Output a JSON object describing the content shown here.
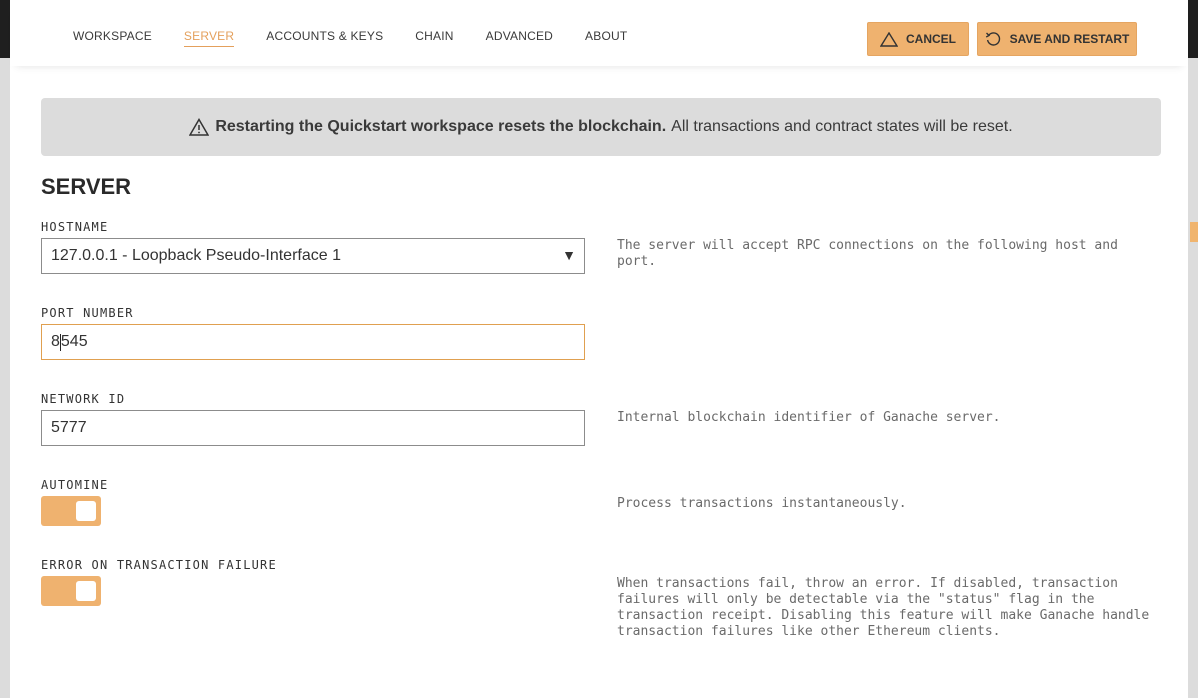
{
  "nav": {
    "items": [
      {
        "label": "WORKSPACE"
      },
      {
        "label": "SERVER",
        "active": true
      },
      {
        "label": "ACCOUNTS & KEYS"
      },
      {
        "label": "CHAIN"
      },
      {
        "label": "ADVANCED"
      },
      {
        "label": "ABOUT"
      }
    ]
  },
  "buttons": {
    "cancel_label": "CANCEL",
    "save_label": "SAVE AND RESTART"
  },
  "warning": {
    "bold_text": "Restarting the Quickstart workspace resets the blockchain.",
    "text": "All transactions and contract states will be reset."
  },
  "section": {
    "title": "SERVER"
  },
  "fields": {
    "hostname": {
      "label": "HOSTNAME",
      "value": "127.0.0.1 - Loopback Pseudo-Interface 1",
      "description": "The server will accept RPC connections on the following host and port."
    },
    "port": {
      "label": "PORT NUMBER",
      "value_before_cursor": "8",
      "value_after_cursor": "545"
    },
    "network_id": {
      "label": "NETWORK ID",
      "value": "5777",
      "description": "Internal blockchain identifier of Ganache server."
    },
    "automine": {
      "label": "AUTOMINE",
      "enabled": true,
      "description": "Process transactions instantaneously."
    },
    "error_on_failure": {
      "label": "ERROR ON TRANSACTION FAILURE",
      "enabled": true,
      "description": "When transactions fail, throw an error. If disabled, transaction failures will only be detectable via the \"status\" flag in the transaction receipt. Disabling this feature will make Ganache handle transaction failures like other Ethereum clients."
    }
  },
  "colors": {
    "accent": "#efb26f",
    "active_tab": "#e4a05c",
    "warning_bg": "#dcdcdc"
  },
  "icons": {
    "cancel": "warning-triangle-icon",
    "save": "restart-icon",
    "warning": "warning-triangle-icon",
    "dropdown": "dropdown-arrow-icon"
  }
}
